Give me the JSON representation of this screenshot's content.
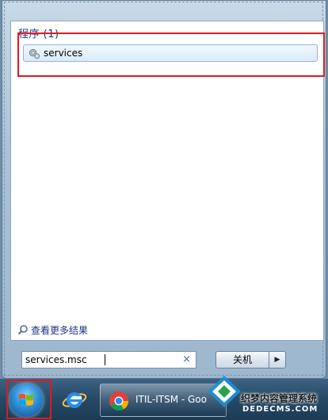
{
  "start_menu": {
    "group_header": "程序 (1)",
    "result_item": {
      "label": "services",
      "icon": "gears-icon"
    },
    "see_more_label": "查看更多结果",
    "search": {
      "value": "services.msc",
      "clear_icon": "×"
    },
    "shutdown_label": "关机",
    "shutdown_arrow": "▶"
  },
  "taskbar": {
    "start_icon": "windows-orb-icon",
    "pinned": [
      {
        "icon": "internet-explorer-icon"
      }
    ],
    "task_button": {
      "icon": "chrome-icon",
      "label": "ITIL-ITSM - Goo"
    }
  },
  "watermark": {
    "title": "织梦内容管理系统",
    "url": "DEDECMS.COM"
  },
  "colors": {
    "highlight": "#e0191f",
    "link": "#1e3287",
    "taskbar": "#284b68"
  }
}
